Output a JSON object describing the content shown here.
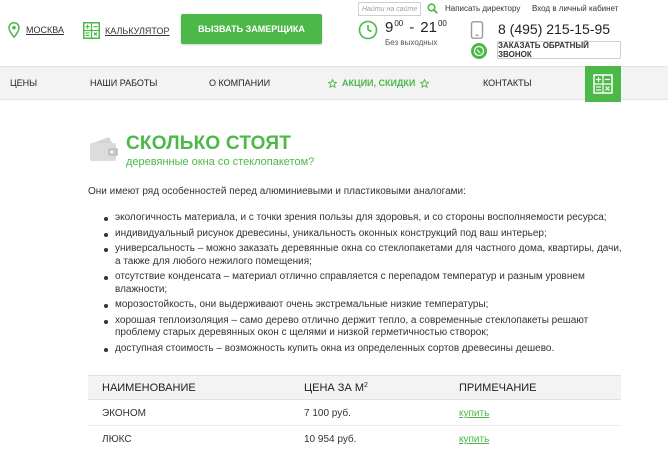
{
  "header": {
    "city": "МОСКВА",
    "calculator": "КАЛЬКУЛЯТОР",
    "cta": "ВЫЗВАТЬ ЗАМЕРЩИКА",
    "search_placeholder": "Найти на сайте",
    "write_director": "Написать директору",
    "login": "Вход в личный кабинет",
    "hours_from": "9",
    "hours_from_min": "00",
    "hours_dash": "-",
    "hours_to": "21",
    "hours_to_min": "00",
    "hours_note": "Без выходных",
    "phone": "8 (495) 215-15-95",
    "callback": "ЗАКАЗАТЬ ОБРАТНЫЙ ЗВОНОК"
  },
  "nav": {
    "items": [
      "ЦЕНЫ",
      "НАШИ РАБОТЫ",
      "О КОМПАНИИ",
      "АКЦИИ, СКИДКИ",
      "КОНТАКТЫ"
    ]
  },
  "content": {
    "title": "СКОЛЬКО СТОЯТ",
    "subtitle": "деревянные окна со стеклопакетом?",
    "intro": "Они имеют ряд особенностей перед алюминиевыми и пластиковыми аналогами:",
    "bullets": [
      "экологичность материала, и с точки зрения пользы для здоровья, и со стороны восполняемости ресурса;",
      "индивидуальный рисунок древесины, уникальность оконных конструкций под ваш интерьер;",
      "универсальность – можно заказать деревянные окна со стеклопакетами для частного дома, квартиры, дачи, а также для любого нежилого помещения;",
      "отсутствие конденсата – материал отлично справляется с перепадом температур и разным уровнем влажности;",
      "морозостойкость, они выдерживают очень экстремальные низкие температуры;",
      "хорошая теплоизоляция – само дерево отлично держит тепло, а современные стеклопакеты решают проблему старых деревянных окон с щелями и низкой герметичностью створок;",
      "доступная стоимость – возможность купить окна из определенных сортов древесины дешево."
    ]
  },
  "table": {
    "col_name": "НАИМЕНОВАНИЕ",
    "col_price": "ЦЕНА ЗА М",
    "col_price_sup": "2",
    "col_note": "ПРИМЕЧАНИЕ",
    "rows": [
      {
        "name": "ЭКОНОМ",
        "price": "7 100 руб.",
        "action": "купить"
      },
      {
        "name": "ЛЮКС",
        "price": "10 954 руб.",
        "action": "купить"
      }
    ]
  },
  "colors": {
    "accent": "#4cb848",
    "nav_bg": "#f3f3f3",
    "text": "#333333"
  },
  "icons": [
    "map-pin-icon",
    "calculator-icon",
    "search-icon",
    "clock-icon",
    "phone-icon",
    "whatsapp-icon",
    "star-icon",
    "wallet-icon"
  ]
}
